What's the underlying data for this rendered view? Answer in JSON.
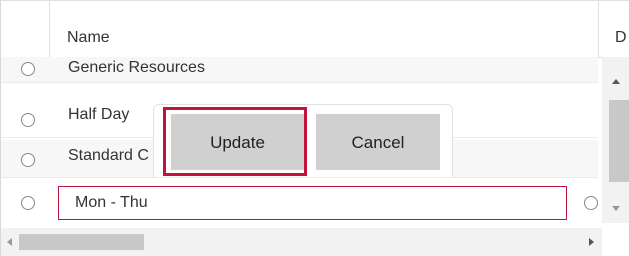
{
  "grid": {
    "columns": [
      "Name",
      "D"
    ]
  },
  "rows": [
    {
      "label": "Generic Resources"
    },
    {
      "label": "Half Day"
    },
    {
      "label": "Standard C"
    }
  ],
  "editor": {
    "value": "Mon - Thu"
  },
  "popup": {
    "update_label": "Update",
    "cancel_label": "Cancel"
  },
  "colors": {
    "focus": "#c1143c",
    "button_bg": "#d0d0d0",
    "row_alt": "#f7f7f7"
  }
}
